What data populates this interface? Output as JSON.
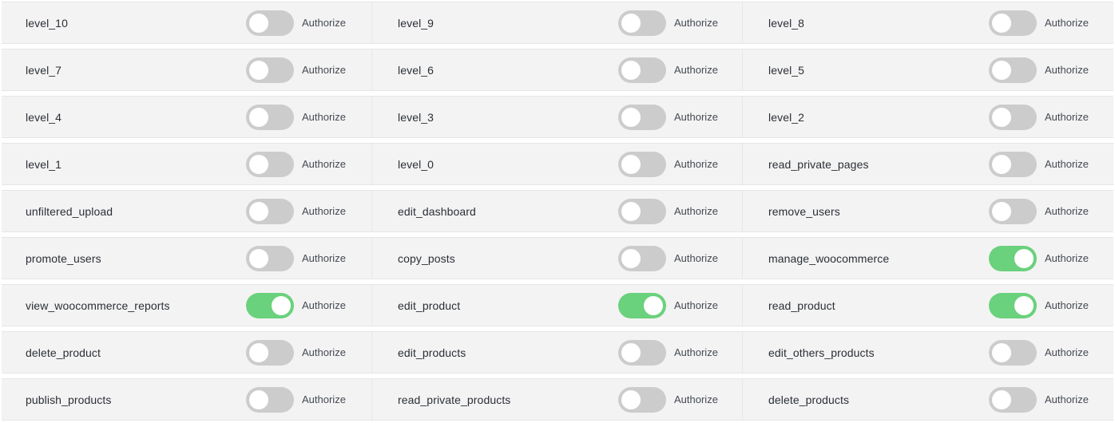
{
  "capabilities": [
    {
      "name": "level_10",
      "status": "Authorize",
      "enabled": false
    },
    {
      "name": "level_9",
      "status": "Authorize",
      "enabled": false
    },
    {
      "name": "level_8",
      "status": "Authorize",
      "enabled": false
    },
    {
      "name": "level_7",
      "status": "Authorize",
      "enabled": false
    },
    {
      "name": "level_6",
      "status": "Authorize",
      "enabled": false
    },
    {
      "name": "level_5",
      "status": "Authorize",
      "enabled": false
    },
    {
      "name": "level_4",
      "status": "Authorize",
      "enabled": false
    },
    {
      "name": "level_3",
      "status": "Authorize",
      "enabled": false
    },
    {
      "name": "level_2",
      "status": "Authorize",
      "enabled": false
    },
    {
      "name": "level_1",
      "status": "Authorize",
      "enabled": false
    },
    {
      "name": "level_0",
      "status": "Authorize",
      "enabled": false
    },
    {
      "name": "read_private_pages",
      "status": "Authorize",
      "enabled": false
    },
    {
      "name": "unfiltered_upload",
      "status": "Authorize",
      "enabled": false
    },
    {
      "name": "edit_dashboard",
      "status": "Authorize",
      "enabled": false
    },
    {
      "name": "remove_users",
      "status": "Authorize",
      "enabled": false
    },
    {
      "name": "promote_users",
      "status": "Authorize",
      "enabled": false
    },
    {
      "name": "copy_posts",
      "status": "Authorize",
      "enabled": false
    },
    {
      "name": "manage_woocommerce",
      "status": "Authorize",
      "enabled": true
    },
    {
      "name": "view_woocommerce_reports",
      "status": "Authorize",
      "enabled": true
    },
    {
      "name": "edit_product",
      "status": "Authorize",
      "enabled": true
    },
    {
      "name": "read_product",
      "status": "Authorize",
      "enabled": true
    },
    {
      "name": "delete_product",
      "status": "Authorize",
      "enabled": false
    },
    {
      "name": "edit_products",
      "status": "Authorize",
      "enabled": false
    },
    {
      "name": "edit_others_products",
      "status": "Authorize",
      "enabled": false
    },
    {
      "name": "publish_products",
      "status": "Authorize",
      "enabled": false
    },
    {
      "name": "read_private_products",
      "status": "Authorize",
      "enabled": false
    },
    {
      "name": "delete_products",
      "status": "Authorize",
      "enabled": false
    }
  ],
  "colors": {
    "toggle_on": "#6ad17c",
    "toggle_off": "#cccccc",
    "row_background": "#f3f3f3"
  }
}
